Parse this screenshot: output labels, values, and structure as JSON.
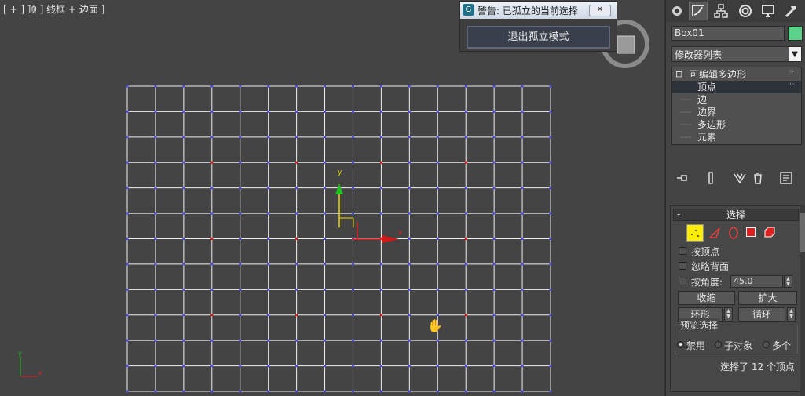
{
  "viewport": {
    "label": "[ + ] 顶 ] 线框 + 边面 ]",
    "axis_gizmo": {
      "x": "x",
      "y": "y"
    },
    "corner_axis": {
      "x": "x",
      "y": "y"
    }
  },
  "dialog": {
    "title": "警告: 已孤立的当前选择",
    "app_icon": "G",
    "close": "✕",
    "exit_button": "退出孤立模式"
  },
  "command_panel": {
    "tabs": [
      "create-icon",
      "modify-icon",
      "hierarchy-icon",
      "motion-icon",
      "display-icon",
      "utilities-icon"
    ],
    "object_name": "Box01",
    "object_color": "#5bd28a",
    "modifier_list": "修改器列表",
    "stack": {
      "root": "可编辑多边形",
      "items": [
        "顶点",
        "边",
        "边界",
        "多边形",
        "元素"
      ],
      "selected": "顶点"
    },
    "rollout": {
      "title": "选择",
      "collapse": "-",
      "by_vertex": "按顶点",
      "ignore_backfacing": "忽略背面",
      "by_angle": "按角度:",
      "angle_value": "45.0",
      "shrink": "收缩",
      "grow": "扩大",
      "ring": "环形",
      "loop": "循环",
      "preview_group": "预览选择",
      "preview_options": [
        "禁用",
        "子对象",
        "多个"
      ],
      "status": "选择了 12 个顶点"
    }
  },
  "colors": {
    "viewport_bg": "#444444",
    "grid_line": "#f0f0f0",
    "vertex": "#4a4ad8",
    "selected_vertex": "#d01818",
    "vertex_mode_icon": "#ffee00"
  }
}
